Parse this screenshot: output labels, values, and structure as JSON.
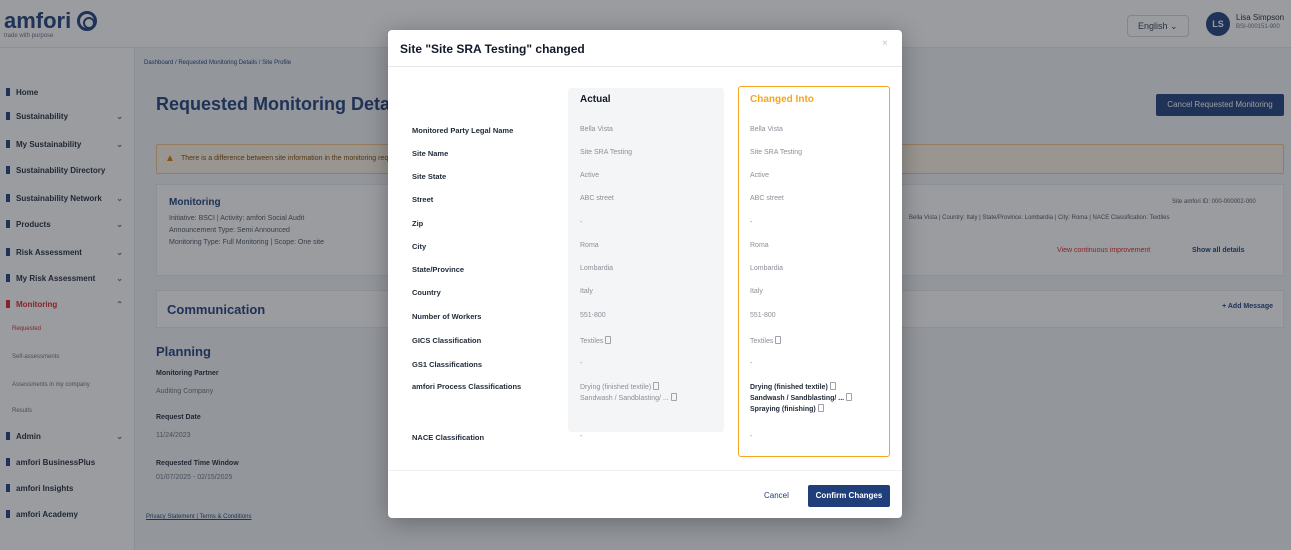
{
  "header": {
    "logo_text": "amfori",
    "logo_sub": "trade with purpose",
    "language": "English ⌄",
    "avatar_initials": "LS",
    "user_name": "Lisa Simpson",
    "user_id": "BSI-000151-900"
  },
  "sidebar": {
    "items": [
      {
        "label": "Home",
        "top": 0
      },
      {
        "label": "Sustainability",
        "top": 0
      },
      {
        "label": "My Sustainability",
        "top": 0
      },
      {
        "label": "Sustainability Directory",
        "top": 0
      },
      {
        "label": "Sustainability Network",
        "top": 0
      },
      {
        "label": "Products",
        "top": 0
      },
      {
        "label": "Risk Assessment",
        "top": 0
      },
      {
        "label": "My Risk Assessment",
        "top": 0
      },
      {
        "label": "Monitoring",
        "top": 0
      }
    ],
    "sub_items": [
      "Requested",
      "Self-assessments",
      "Assessments in my company",
      "Results"
    ],
    "bottom_items": [
      "Admin",
      "amfori BusinessPlus",
      "amfori Insights",
      "amfori Academy"
    ]
  },
  "main": {
    "breadcrumb": "Dashboard / Requested Monitoring Details / Site Profile",
    "title": "Requested Monitoring Details",
    "cancel_button": "Cancel Requested Monitoring",
    "alert_text": "There is a difference between site information in the monitoring request and the site information in the site profile.",
    "monitoring": {
      "title": "Monitoring",
      "line1": "Initiative: BSCI | Activity: amfori Social Audit",
      "line2": "Announcement Type: Semi Announced",
      "line3": "Monitoring Type: Full Monitoring | Scope: One site",
      "right_top": "Site amfori ID: 000-000002-000",
      "right_mid": "Bella Vista | Country: Italy | State/Province: Lombardia | City: Roma | NACE Classification: Textiles",
      "link_compare": "View continuous improvement",
      "link_details": "Show all details"
    },
    "communication_title": "Communication",
    "add_message": "+ Add Message",
    "planning": {
      "title": "Planning",
      "label1": "Monitoring Partner",
      "value1": "Auditing Company",
      "label2": "Request Date",
      "value2": "11/24/2023",
      "label3": "Requested Time Window",
      "value3": "01/07/2025 - 02/15/2025"
    },
    "footer": "Privacy Statement | Terms & Conditions"
  },
  "modal": {
    "title": "Site \"Site SRA Testing\" changed",
    "close": "×",
    "col_actual": "Actual",
    "col_changed": "Changed Into",
    "rows": [
      {
        "label": "Monitored Party Legal Name",
        "actual": "Bella Vista",
        "changed": "Bella Vista"
      },
      {
        "label": "Site Name",
        "actual": "Site SRA Testing",
        "changed": "Site SRA Testing"
      },
      {
        "label": "Site State",
        "actual": "Active",
        "changed": "Active"
      },
      {
        "label": "Street",
        "actual": "ABC street",
        "changed": "ABC street"
      },
      {
        "label": "Zip",
        "actual": "-",
        "changed": "-"
      },
      {
        "label": "City",
        "actual": "Roma",
        "changed": "Roma"
      },
      {
        "label": "State/Province",
        "actual": "Lombardia",
        "changed": "Lombardia"
      },
      {
        "label": "Country",
        "actual": "Italy",
        "changed": "Italy"
      },
      {
        "label": "Number of Workers",
        "actual": "551-800",
        "changed": "551-800"
      },
      {
        "label": "GICS Classification",
        "actual": "Textiles",
        "changed": "Textiles"
      },
      {
        "label": "GS1 Classifications",
        "actual": "-",
        "changed": "-"
      }
    ],
    "process": {
      "label": "amfori Process Classifications",
      "actual1": "Drying (finished textile)",
      "actual2": "Sandwash / Sandblasting/ ...",
      "changed1": "Drying (finished textile)",
      "changed2": "Sandwash / Sandblasting/ ...",
      "changed3": "Spraying (finishing)"
    },
    "nace": {
      "label": "NACE Classification",
      "actual": "-",
      "changed": "-"
    },
    "cancel": "Cancel",
    "confirm": "Confirm Changes"
  }
}
